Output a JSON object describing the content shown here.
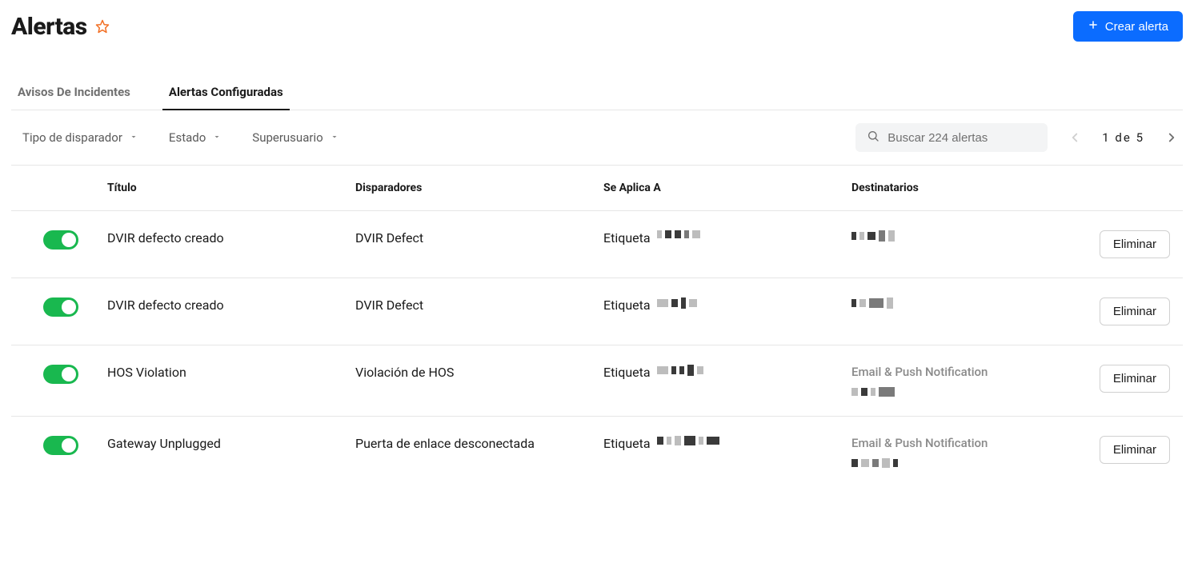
{
  "header": {
    "title": "Alertas",
    "create_button": "Crear alerta"
  },
  "tabs": [
    {
      "label": "Avisos De Incidentes",
      "active": false
    },
    {
      "label": "Alertas Configuradas",
      "active": true
    }
  ],
  "filters": [
    {
      "label": "Tipo de disparador"
    },
    {
      "label": "Estado"
    },
    {
      "label": "Superusuario"
    }
  ],
  "search": {
    "placeholder": "Buscar 224 alertas"
  },
  "pagination": {
    "current": "1",
    "sep": "de",
    "total": "5"
  },
  "columns": {
    "toggle": "",
    "title": "Título",
    "triggers": "Disparadores",
    "applies_to": "Se Aplica A",
    "recipients": "Destinatarios",
    "actions": ""
  },
  "applies_prefix": "Etiqueta",
  "delete_label": "Eliminar",
  "recipient_channel_label": "Email & Push Notification",
  "rows": [
    {
      "title": "DVIR defecto creado",
      "trigger": "DVIR Defect",
      "applies_to": "Etiqueta",
      "recipient_channel": "",
      "recipient_redacted": true
    },
    {
      "title": "DVIR defecto creado",
      "trigger": "DVIR Defect",
      "applies_to": "Etiqueta",
      "recipient_channel": "",
      "recipient_redacted": true
    },
    {
      "title": "HOS Violation",
      "trigger": "Violación de HOS",
      "applies_to": "Etiqueta",
      "recipient_channel": "Email & Push Notification",
      "recipient_redacted": true
    },
    {
      "title": "Gateway Unplugged",
      "trigger": "Puerta de enlace desconectada",
      "applies_to": "Etiqueta",
      "recipient_channel": "Email & Push Notification",
      "recipient_redacted": true
    }
  ]
}
